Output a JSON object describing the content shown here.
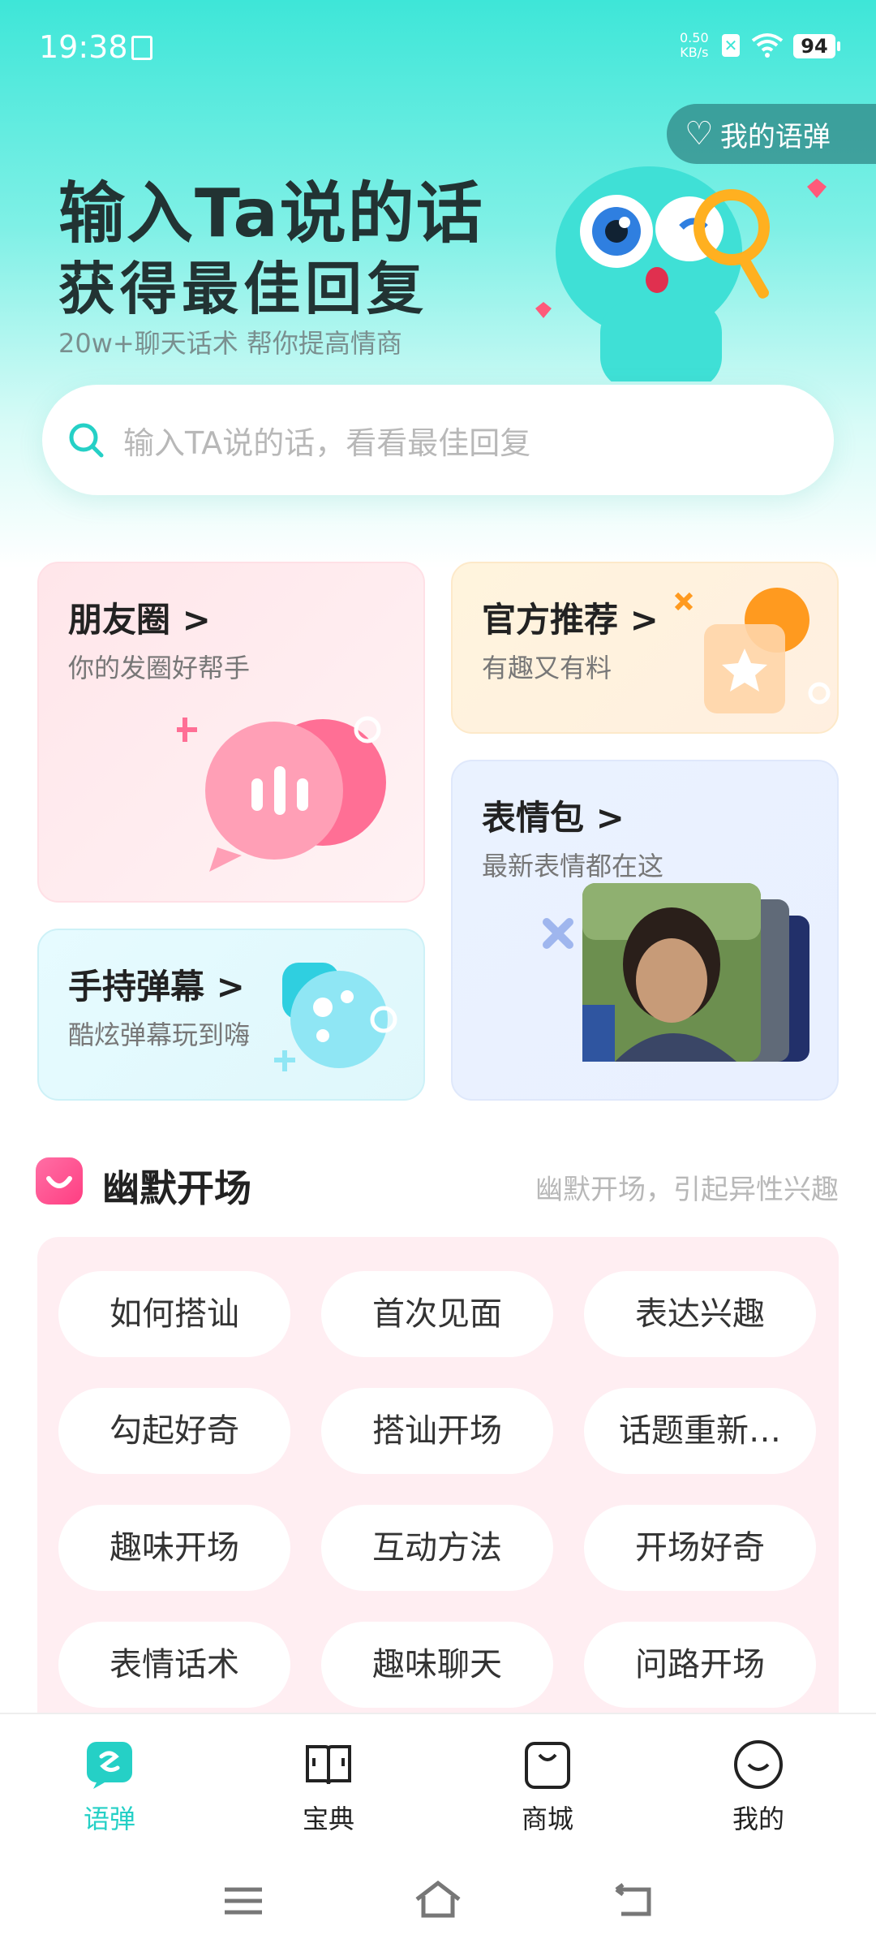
{
  "status_bar": {
    "time": "19:38",
    "net_speed_value": "0.50",
    "net_speed_unit": "KB/s",
    "battery": "94"
  },
  "hero": {
    "title_line1": "输入Ta说的话",
    "title_line2": "获得最佳回复",
    "subtitle": "20w+聊天话术 帮你提高情商",
    "my_button": "我的语弹"
  },
  "search": {
    "placeholder": "输入TA说的话，看看最佳回复"
  },
  "cards": {
    "moments": {
      "title": "朋友圈 >",
      "subtitle": "你的发圈好帮手"
    },
    "official": {
      "title": "官方推荐 >",
      "subtitle": "有趣又有料"
    },
    "stickers": {
      "title": "表情包 >",
      "subtitle": "最新表情都在这"
    },
    "danmaku": {
      "title": "手持弹幕 >",
      "subtitle": "酷炫弹幕玩到嗨"
    }
  },
  "section": {
    "title": "幽默开场",
    "subtitle": "幽默开场，引起异性兴趣"
  },
  "tags": [
    "如何搭讪",
    "首次见面",
    "表达兴趣",
    "勾起好奇",
    "搭讪开场",
    "话题重新…",
    "趣味开场",
    "互动方法",
    "开场好奇",
    "表情话术",
    "趣味聊天",
    "问路开场"
  ],
  "tabbar": {
    "items": [
      {
        "label": "语弹",
        "icon": "chat-bubble-icon",
        "active": true
      },
      {
        "label": "宝典",
        "icon": "book-icon",
        "active": false
      },
      {
        "label": "商城",
        "icon": "shopping-bag-icon",
        "active": false
      },
      {
        "label": "我的",
        "icon": "smile-face-icon",
        "active": false
      }
    ]
  },
  "colors": {
    "accent": "#25d0c6",
    "hero_gradient_top": "#3ee6d8",
    "section_pink": "#ff3e82"
  }
}
